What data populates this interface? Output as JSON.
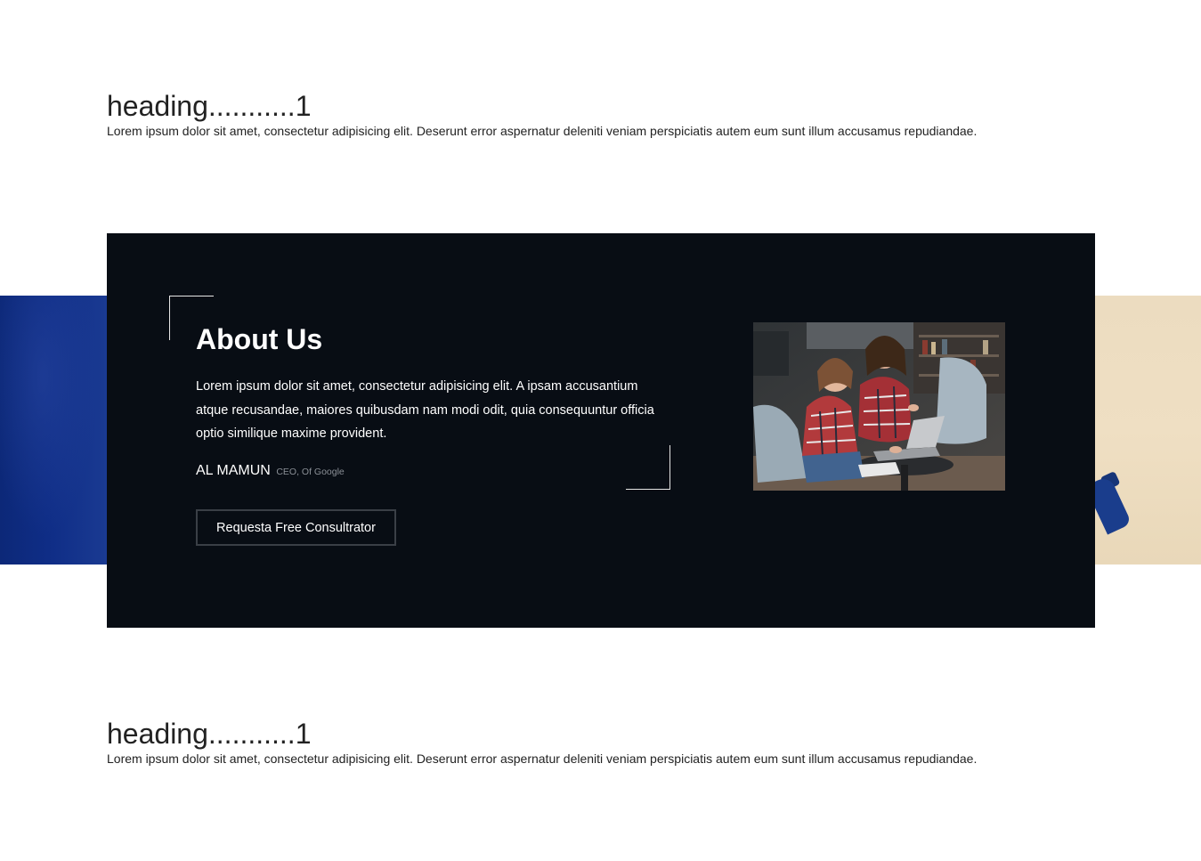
{
  "sections": {
    "top": {
      "heading": "heading...........1",
      "text": "Lorem ipsum dolor sit amet, consectetur adipisicing elit. Deserunt error aspernatur deleniti veniam perspiciatis autem eum sunt illum accusamus repudiandae."
    },
    "bottom": {
      "heading": "heading...........1",
      "text": "Lorem ipsum dolor sit amet, consectetur adipisicing elit. Deserunt error aspernatur deleniti veniam perspiciatis autem eum sunt illum accusamus repudiandae."
    }
  },
  "about": {
    "title": "About Us",
    "text": "Lorem ipsum dolor sit amet, consectetur adipisicing elit. A ipsam accusantium atque recusandae, maiores quibusdam nam modi odit, quia consequuntur officia optio similique maxime provident.",
    "author_name": "AL MAMUN",
    "author_role": "CEO, Of Google",
    "cta_label": "Requesta Free Consultrator",
    "image": "two-women-laptop-photo"
  },
  "colors": {
    "panel_bg": "#080d14",
    "left_image": "#0f2d86",
    "right_image": "#ecdcc0"
  }
}
